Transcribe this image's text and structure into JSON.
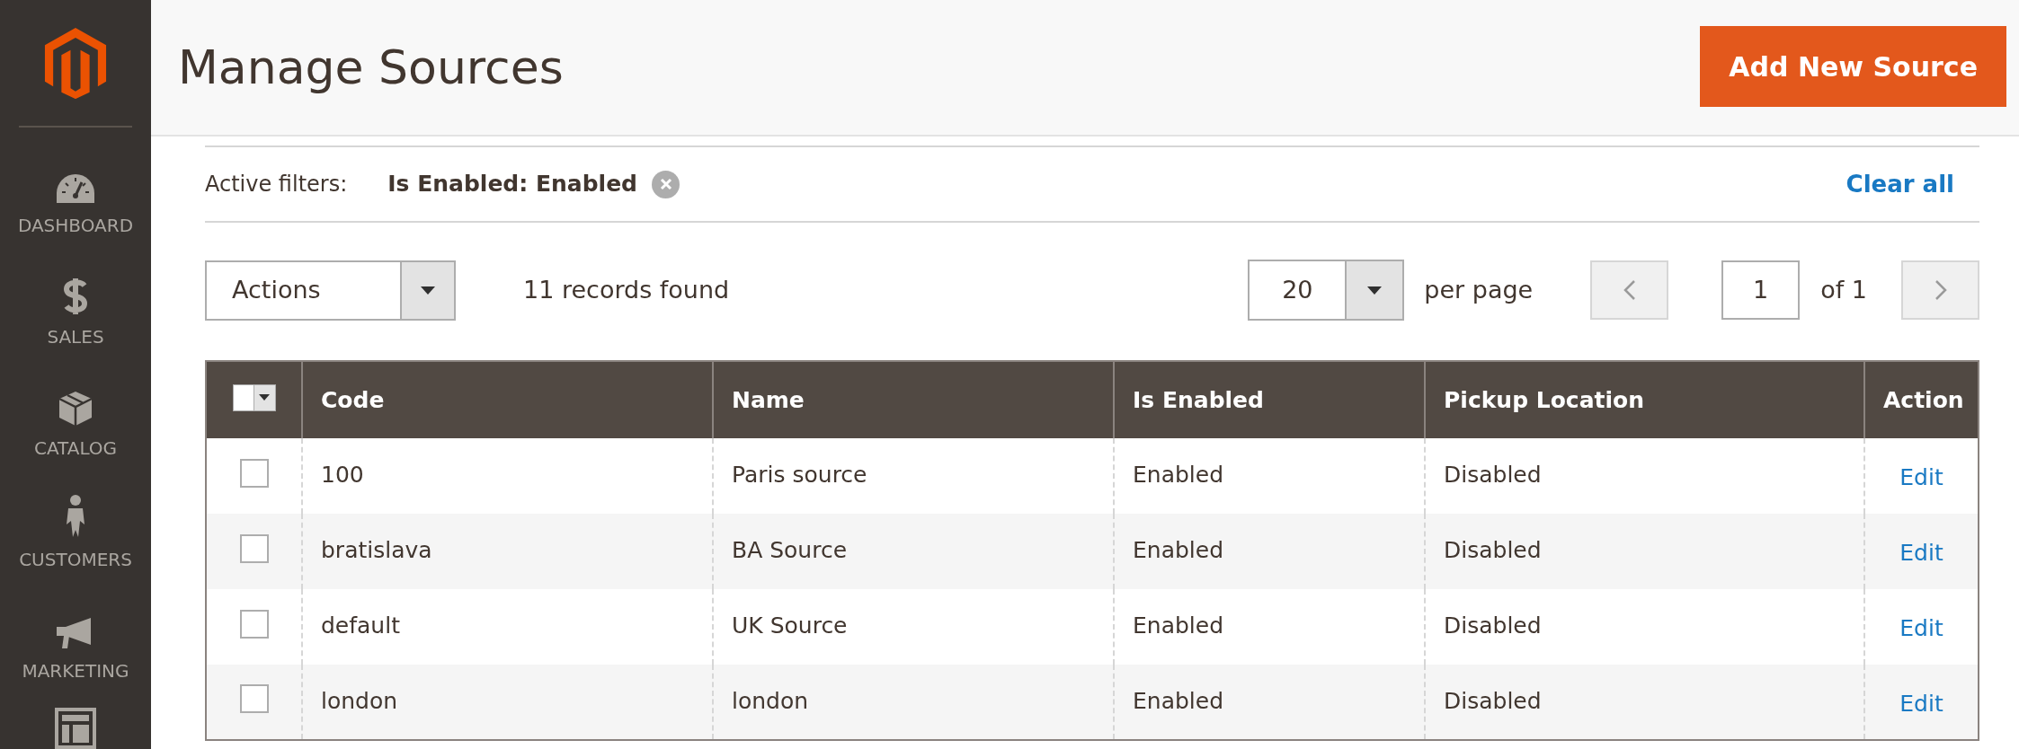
{
  "sidebar": {
    "items": [
      {
        "label": "DASHBOARD",
        "selected": false
      },
      {
        "label": "SALES",
        "selected": false
      },
      {
        "label": "CATALOG",
        "selected": false
      },
      {
        "label": "CUSTOMERS",
        "selected": false
      },
      {
        "label": "MARKETING",
        "selected": false
      }
    ]
  },
  "header": {
    "title": "Manage Sources",
    "primary_button": "Add New Source"
  },
  "active_filters": {
    "label": "Active filters:",
    "filters": [
      {
        "text": "Is Enabled: Enabled"
      }
    ],
    "clear_all": "Clear all"
  },
  "toolbar": {
    "actions": "Actions",
    "records": "11 records found",
    "page_size": "20",
    "per_page": "per page",
    "page": "1",
    "of_pages": "of 1"
  },
  "table": {
    "select_all_checked": false,
    "columns": [
      "Code",
      "Name",
      "Is Enabled",
      "Pickup Location",
      "Action"
    ],
    "rows": [
      {
        "checked": false,
        "cells": [
          "100",
          "Paris source",
          "Enabled",
          "Disabled"
        ],
        "action": "Edit"
      },
      {
        "checked": false,
        "cells": [
          "bratislava",
          "BA Source",
          "Enabled",
          "Disabled"
        ],
        "action": "Edit"
      },
      {
        "checked": false,
        "cells": [
          "default",
          "UK Source",
          "Enabled",
          "Disabled"
        ],
        "action": "Edit"
      },
      {
        "checked": false,
        "cells": [
          "london",
          "london",
          "Enabled",
          "Disabled"
        ],
        "action": "Edit"
      }
    ]
  }
}
